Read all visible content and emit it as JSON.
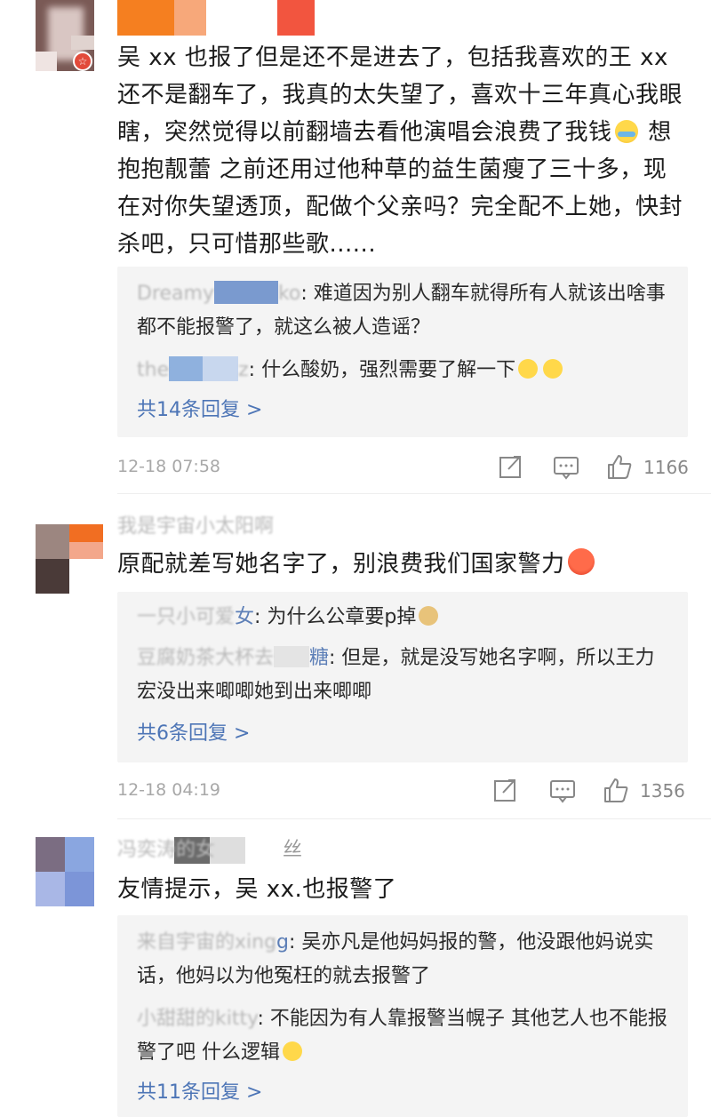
{
  "comments": [
    {
      "body_parts": [
        "吴 xx 也报了但是还不是进去了，包括我喜欢的王 xx 还不是翻车了，我真的太失望了，喜欢十三年真心我眼瞎，突然觉得以前翻墙去看他演唱会浪费了我钱",
        "想抱抱靓蕾 之前还用过他种草的益生菌瘦了三十多，现在对你失望透顶，配做个父亲吗？完全配不上她，快封杀吧，只可惜那些歌......"
      ],
      "emoji_mid": "laughing-crying-emoji",
      "replies": [
        {
          "name_tail": "ko",
          "text": ": 难道因为别人翻车就得所有人就该出啥事都不能报警了，就这么被人造谣？"
        },
        {
          "name_tail": "z",
          "text": ": 什么酸奶，强烈需要了解一下"
        }
      ],
      "more_replies": "共14条回复 >",
      "timestamp": "12-18 07:58",
      "likes": "1166"
    },
    {
      "username": "我是宇宙小太阳啊",
      "body": "原配就差写她名字了，别浪费我们国家警力",
      "replies": [
        {
          "name_tail": "女",
          "text": ": 为什么公章要p掉"
        },
        {
          "name_tail": "糖",
          "text": ": 但是，就是没写她名字啊，所以王力宏没出来唧唧她到出来唧唧"
        }
      ],
      "more_replies": "共6条回复 >",
      "timestamp": "12-18 04:19",
      "likes": "1356"
    },
    {
      "username": "丝",
      "body": "友情提示，吴 xx.也报警了",
      "replies": [
        {
          "name_tail": "g",
          "text": ": 吴亦凡是他妈妈报的警，他没跟他妈说实话，他妈以为他冤枉的就去报警了"
        },
        {
          "name_tail": "",
          "text": ": 不能因为有人靠报警当幌子 其他艺人也不能报警了吧 什么逻辑"
        }
      ],
      "more_replies": "共11条回复 >",
      "timestamp": "",
      "likes": ""
    }
  ],
  "colors": {
    "link_blue": "#4d75b6",
    "reply_bg": "#f4f4f4",
    "meta_gray": "#a8a8a8"
  }
}
